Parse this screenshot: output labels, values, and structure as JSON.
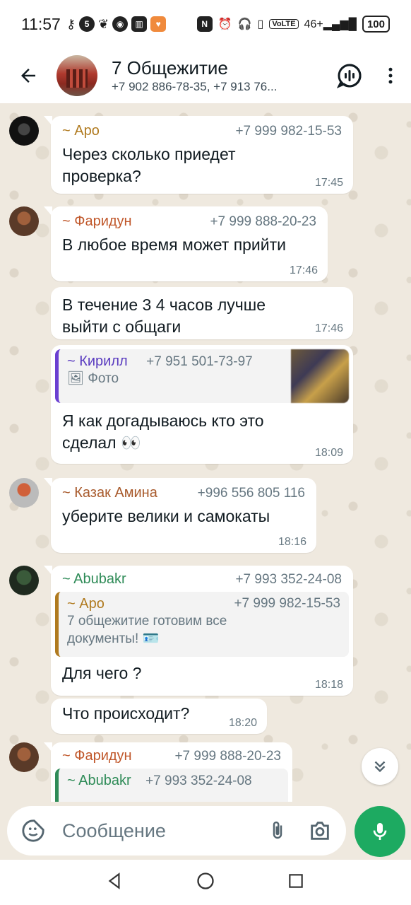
{
  "status_bar": {
    "time": "11:57",
    "battery": "100",
    "network": "46+"
  },
  "header": {
    "title": "7 Общежитие",
    "subtitle": "+7 902 886-78-35, +7 913 76..."
  },
  "composer": {
    "placeholder": "Сообщение"
  },
  "colors": {
    "accent": "#1daa61",
    "name_apo": "#b07a1f",
    "name_faridun": "#c0572a",
    "name_kirill": "#5a3cc0",
    "name_amina": "#a85a2c",
    "name_abubakr": "#2e8b57"
  },
  "messages": [
    {
      "sender": "~ Аро",
      "phone": "+7 999 982-15-53",
      "text": "Через сколько приедет проверка?",
      "time": "17:45"
    },
    {
      "sender": "~ Фаридун",
      "phone": "+7 999 888-20-23",
      "text": "В любое время может прийти",
      "time": "17:46"
    },
    {
      "text": "В течение 3 4 часов лучше выйти с общаги",
      "time": "17:46"
    },
    {
      "quote": {
        "sender": "~ Кирилл",
        "phone": "+7 951 501-73-97",
        "text": "Фото"
      },
      "text": "Я как догадываюсь кто это сделал 👀",
      "time": "18:09"
    },
    {
      "sender": "~ Казак Амина",
      "phone": "+996 556 805 116",
      "text": "уберите велики и самокаты",
      "time": "18:16"
    },
    {
      "sender": "~ Abubakr",
      "phone": "+7 993 352-24-08",
      "quote": {
        "sender": "~ Аро",
        "phone": "+7 999 982-15-53",
        "text": "7 общежитие готовим все документы! 🪪"
      },
      "text": "Для чего ?",
      "time": "18:18"
    },
    {
      "text": "Что происходит?",
      "time": "18:20"
    },
    {
      "sender": "~ Фаридун",
      "phone": "+7 999 888-20-23",
      "quote": {
        "sender": "~ Abubakr",
        "phone": "+7 993 352-24-08"
      }
    }
  ]
}
